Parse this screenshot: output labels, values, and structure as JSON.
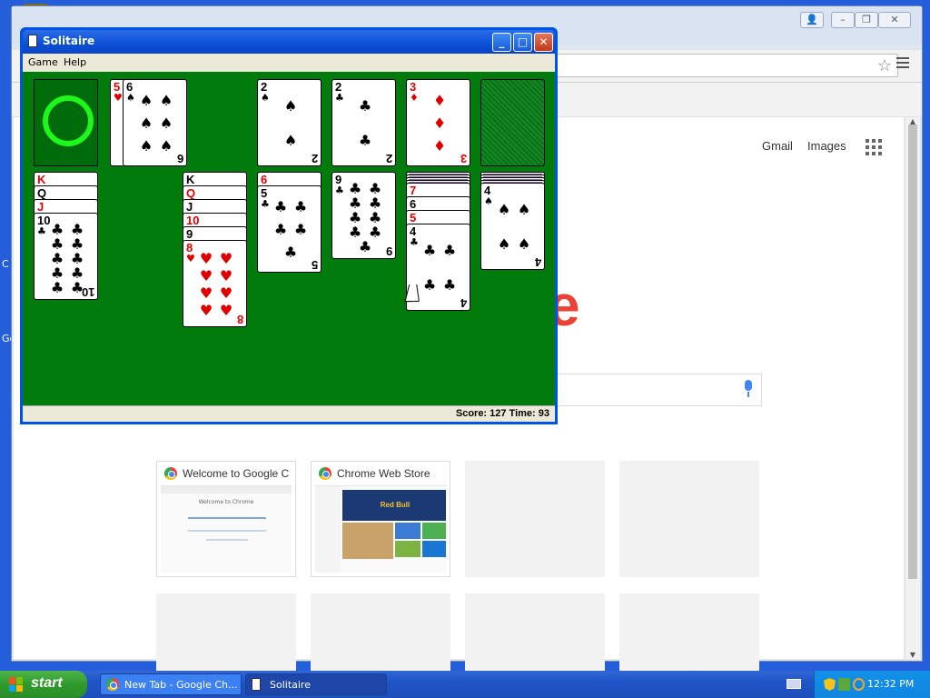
{
  "desktop": {
    "edge_text_1": "C",
    "edge_text_2": "Go"
  },
  "chrome": {
    "window_controls": [
      "👤",
      "–",
      "❐",
      "✕"
    ],
    "ntp": {
      "gmail": "Gmail",
      "images": "Images",
      "logo_fragment": "e",
      "tiles": [
        {
          "title": "Welcome to Google C",
          "thumb_title": "Welcome to Chrome"
        },
        {
          "title": "Chrome Web Store",
          "thumb_title": "Red Bull"
        }
      ]
    }
  },
  "solitaire": {
    "title": "Solitaire",
    "menu": [
      "Game",
      "Help"
    ],
    "status": "Score: 127 Time: 93",
    "waste": [
      {
        "rank": "5",
        "suit": "♥",
        "color": "red"
      },
      {
        "rank": "6",
        "suit": "♠",
        "color": "black"
      }
    ],
    "foundations": [
      {
        "rank": "2",
        "suit": "♠",
        "color": "black"
      },
      {
        "rank": "2",
        "suit": "♣",
        "color": "black"
      },
      {
        "rank": "3",
        "suit": "♦",
        "color": "red"
      }
    ],
    "tableau": [
      {
        "cards": [
          {
            "rank": "K",
            "suit": "♥",
            "color": "red"
          },
          {
            "rank": "Q",
            "suit": "♠",
            "color": "black"
          },
          {
            "rank": "J",
            "suit": "♦",
            "color": "red"
          },
          {
            "rank": "10",
            "suit": "♣",
            "color": "black"
          }
        ]
      },
      {
        "cards": []
      },
      {
        "cards": [
          {
            "rank": "K",
            "suit": "♠",
            "color": "black"
          },
          {
            "rank": "Q",
            "suit": "♥",
            "color": "red"
          },
          {
            "rank": "J",
            "suit": "♠",
            "color": "black"
          },
          {
            "rank": "10",
            "suit": "♦",
            "color": "red"
          },
          {
            "rank": "9",
            "suit": "♠",
            "color": "black"
          },
          {
            "rank": "8",
            "suit": "♥",
            "color": "red"
          }
        ]
      },
      {
        "cards": [
          {
            "rank": "6",
            "suit": "♦",
            "color": "red"
          },
          {
            "rank": "5",
            "suit": "♣",
            "color": "black"
          }
        ]
      },
      {
        "cards": [
          {
            "rank": "9",
            "suit": "♣",
            "color": "black"
          }
        ]
      },
      {
        "cards": [
          {
            "rank": "7",
            "suit": "♥",
            "color": "red"
          },
          {
            "rank": "6",
            "suit": "♠",
            "color": "black"
          },
          {
            "rank": "5",
            "suit": "♥",
            "color": "red"
          },
          {
            "rank": "4",
            "suit": "♣",
            "color": "black"
          }
        ]
      },
      {
        "cards": [
          {
            "rank": "4",
            "suit": "♠",
            "color": "black"
          }
        ]
      }
    ]
  },
  "taskbar": {
    "start": "start",
    "buttons": [
      {
        "label": "New Tab - Google Ch..."
      },
      {
        "label": "Solitaire"
      }
    ],
    "clock": "12:32 PM"
  },
  "colors": {
    "felt": "#007b0c",
    "xp_blue": "#245edb",
    "start_green": "#2f9a2c"
  }
}
